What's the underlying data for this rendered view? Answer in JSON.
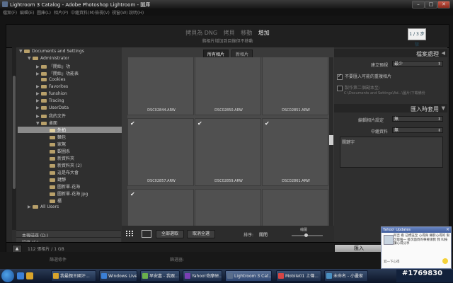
{
  "window": {
    "title": "Lightroom 3 Catalog - Adobe Photoshop Lightroom - 圖庫"
  },
  "menubar": [
    "檔案(F)",
    "編輯(E)",
    "圖庫(L)",
    "相片(P)",
    "中繼資料(M)",
    "檢視(V)",
    "視窗(W)",
    "說明(H)"
  ],
  "dialog": {
    "modes": [
      "拷貝為 DNG",
      "拷貝",
      "移動",
      "增加"
    ],
    "active_mode_index": 3,
    "subtitle": "將相片增加到目錄但不移動",
    "badge": "1 / 3 步驟"
  },
  "tree": {
    "rows": [
      {
        "label": "Documents and Settings",
        "indent": 0,
        "twisty": "▼"
      },
      {
        "label": "Administrator",
        "indent": 1,
        "twisty": "▼"
      },
      {
        "label": "「開始」功",
        "indent": 2,
        "twisty": "▶"
      },
      {
        "label": "「開始」功能表",
        "indent": 2,
        "twisty": "▶"
      },
      {
        "label": "Cookies",
        "indent": 2,
        "twisty": ""
      },
      {
        "label": "Favorites",
        "indent": 2,
        "twisty": "▶"
      },
      {
        "label": "funshion",
        "indent": 2,
        "twisty": "▶"
      },
      {
        "label": "Tracing",
        "indent": 2,
        "twisty": "▶"
      },
      {
        "label": "UserData",
        "indent": 2,
        "twisty": "▶"
      },
      {
        "label": "我的文件",
        "indent": 2,
        "twisty": "▶"
      },
      {
        "label": "桌面",
        "indent": 2,
        "twisty": "▼"
      },
      {
        "label": "外拍",
        "indent": 3,
        "twisty": "",
        "selected": true
      },
      {
        "label": "麵包",
        "indent": 3,
        "twisty": ""
      },
      {
        "label": "家駕",
        "indent": 3,
        "twisty": ""
      },
      {
        "label": "觀圖系",
        "indent": 3,
        "twisty": ""
      },
      {
        "label": "新資料夾",
        "indent": 3,
        "twisty": ""
      },
      {
        "label": "新資料夾 (2)",
        "indent": 3,
        "twisty": ""
      },
      {
        "label": "這是布大會",
        "indent": 3,
        "twisty": ""
      },
      {
        "label": "鍵靜",
        "indent": 3,
        "twisty": ""
      },
      {
        "label": "圖新單-花海",
        "indent": 3,
        "twisty": ""
      },
      {
        "label": "圖新單-花海 jpg",
        "indent": 3,
        "twisty": ""
      },
      {
        "label": "櫃",
        "indent": 3,
        "twisty": ""
      },
      {
        "label": "All Users",
        "indent": 1,
        "twisty": "▶"
      }
    ],
    "sections": [
      "本機磁碟 (D:)",
      "磁碟 (F:)",
      "音樂 (G:)"
    ]
  },
  "center": {
    "tabs": [
      "所有相片",
      "新相片"
    ],
    "active_tab": 0,
    "cells": [
      {
        "name": "DSC02844.ARW",
        "checked": false
      },
      {
        "name": "DSC02850.ARW",
        "checked": false
      },
      {
        "name": "DSC02851.ARW",
        "checked": false
      },
      {
        "name": "DSC02857.ARW",
        "checked": true
      },
      {
        "name": "DSC02859.ARW",
        "checked": true
      },
      {
        "name": "DSC02861.ARW",
        "checked": true
      },
      {
        "name": "",
        "checked": true
      },
      {
        "name": "",
        "checked": false
      },
      {
        "name": "",
        "checked": false
      }
    ],
    "toolbar": {
      "select_all": "全部選取",
      "deselect_all": "取消全選",
      "sort_label": "排序:",
      "sort_value": "關閉",
      "thumb_label": "縮圖"
    }
  },
  "right": {
    "file_handling": {
      "header": "檔案處理",
      "preview_label": "建立預視",
      "preview_value": "最少",
      "dont_import_dupes": "不要匯入可能的重複相片",
      "dont_import_dupes_checked": true,
      "second_copy": "製作第二個副本至:",
      "second_copy_checked": false,
      "second_copy_path": "C:\\Documents and Settings\\Ad...\\圖片\\下載備份"
    },
    "apply_during_import": {
      "header": "匯入時套用",
      "develop_label": "編輯相片設定",
      "develop_value": "無",
      "metadata_label": "中繼資料",
      "metadata_value": "無",
      "keywords_label": "關鍵字"
    }
  },
  "bottom": {
    "count": "112 張相片 / 1 GB",
    "import_button": "匯入",
    "lr_bottom_left": "篩選條件",
    "lr_bottom_mid": "篩選器:"
  },
  "taskbar": {
    "tasks": [
      {
        "label": "我最親王國汗...",
        "color": "#d9a42b"
      },
      {
        "label": "Windows Live ...",
        "color": "#3b7fd6"
      },
      {
        "label": "早安嘉 - 我跟...",
        "color": "#6ab04c"
      },
      {
        "label": "Yahoo!奇摩研...",
        "color": "#7b3fb5"
      },
      {
        "label": "Lightroom 3 Cat...",
        "color": "#5a6e8c",
        "active": true
      },
      {
        "label": "Mobile01 上傳...",
        "color": "#d64545"
      },
      {
        "label": "未命名 - 小畫家",
        "color": "#4a90c2"
      }
    ]
  },
  "yahoo_popup": {
    "header": "Yahoo! Updates",
    "message": "阿吉 看 已標註至 心得與 攝影心得的 限可能報一 接次面頁的事要請我 我 叫按讚心得分享",
    "footer": "寫一下心得"
  },
  "watermark": "#1769830"
}
